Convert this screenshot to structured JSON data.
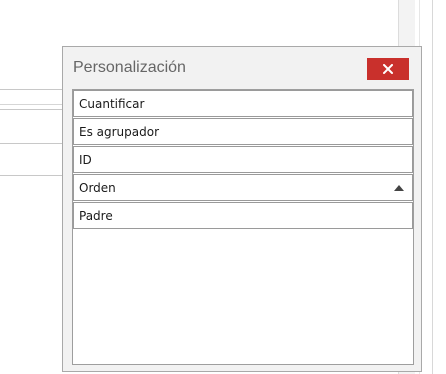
{
  "window": {
    "title": "Personalización",
    "close_icon": "close-icon"
  },
  "fields": [
    {
      "label": "Cuantificar",
      "sort": null
    },
    {
      "label": "Es agrupador",
      "sort": null
    },
    {
      "label": "ID",
      "sort": null
    },
    {
      "label": "Orden",
      "sort": "ascending"
    },
    {
      "label": "Padre",
      "sort": null
    }
  ],
  "colors": {
    "close_button": "#c9302c",
    "window_background": "#f2f2f2",
    "title_text": "#666666"
  }
}
